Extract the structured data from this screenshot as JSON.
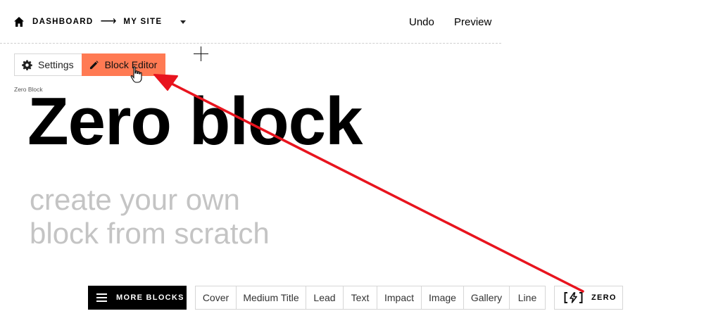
{
  "header": {
    "breadcrumbs": [
      "DASHBOARD",
      "MY SITE"
    ],
    "separator": "⟶",
    "undo_label": "Undo",
    "preview_label": "Preview"
  },
  "block_toolbar": {
    "settings_label": "Settings",
    "editor_label": "Block Editor"
  },
  "block": {
    "label": "Zero Block",
    "headline": "Zero block",
    "subtext_line1": "create your own",
    "subtext_line2": "block from scratch"
  },
  "bottom_bar": {
    "more_blocks_label": "MORE BLOCKS",
    "tabs": [
      "Cover",
      "Medium Title",
      "Lead",
      "Text",
      "Impact",
      "Image",
      "Gallery",
      "Line"
    ],
    "zero_label": "ZERO"
  },
  "colors": {
    "accent": "#ff7a53",
    "annotation_arrow": "#e8141e",
    "subtext": "#c4c4c4"
  },
  "icons": {
    "home": "home-icon",
    "caret": "chevron-down-icon",
    "settings": "gear-icon",
    "editor": "pencil-icon",
    "more_blocks": "menu-icon",
    "zero": "zero-block-icon"
  }
}
